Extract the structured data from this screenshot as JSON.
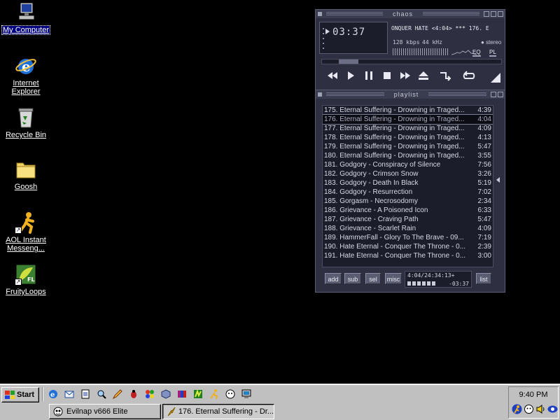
{
  "desktop": {
    "icons": [
      {
        "label": "My Computer"
      },
      {
        "label": "Internet Explorer"
      },
      {
        "label": "Recycle Bin"
      },
      {
        "label": "Goosh"
      },
      {
        "label": "AOL Instant Messeng..."
      },
      {
        "label": "FruityLoops"
      }
    ]
  },
  "winamp": {
    "title": "chaos",
    "time": "03:37",
    "marquee": "ONQUER HATE <4:04>  ***  176. E",
    "kbps": "128 kbps",
    "khz": "44 kHz",
    "stereo": "stereo",
    "eq_label": "EQ",
    "pl_label": "PL",
    "playlist_title": "playlist",
    "tracks": [
      {
        "title": "175. Eternal Suffering - Drowning in Traged...",
        "dur": "4:39"
      },
      {
        "title": "176. Eternal Suffering - Drowning in Traged...",
        "dur": "4:04"
      },
      {
        "title": "177. Eternal Suffering - Drowning in Traged...",
        "dur": "4:09"
      },
      {
        "title": "178. Eternal Suffering - Drowning in Traged...",
        "dur": "4:13"
      },
      {
        "title": "179. Eternal Suffering - Drowning in Traged...",
        "dur": "5:47"
      },
      {
        "title": "180. Eternal Suffering - Drowning in Traged...",
        "dur": "3:55"
      },
      {
        "title": "181. Godgory - Conspiracy of Silence",
        "dur": "7:56"
      },
      {
        "title": "182. Godgory - Crimson Snow",
        "dur": "3:26"
      },
      {
        "title": "183. Godgory - Death In Black",
        "dur": "5:19"
      },
      {
        "title": "184. Godgory - Resurrection",
        "dur": "7:02"
      },
      {
        "title": "185. Gorgasm - Necrosodomy",
        "dur": "2:34"
      },
      {
        "title": "186. Grievance - A Poisoned Icon",
        "dur": "6:33"
      },
      {
        "title": "187. Grievance - Craving Path",
        "dur": "5:47"
      },
      {
        "title": "188. Grievance - Scarlet Rain",
        "dur": "4:09"
      },
      {
        "title": "189. HammerFall - Glory To The Brave - 09...",
        "dur": "7:19"
      },
      {
        "title": "190. Hate Eternal - Conquer The Throne - 0...",
        "dur": "2:39"
      },
      {
        "title": "191. Hate Eternal - Conquer The Throne - 0...",
        "dur": "3:00"
      }
    ],
    "current_index": 1,
    "buttons": {
      "add": "add",
      "sub": "sub",
      "sel": "sel",
      "misc": "misc",
      "list": "list"
    },
    "mini_info": "4:04/24:34:13+",
    "mini_time": "-03:37"
  },
  "taskbar": {
    "start_label": "Start",
    "tasks": [
      {
        "label": "Evilnap v666 Elite"
      },
      {
        "label": "176. Eternal Suffering - Dr..."
      }
    ],
    "clock": "9:40 PM"
  }
}
